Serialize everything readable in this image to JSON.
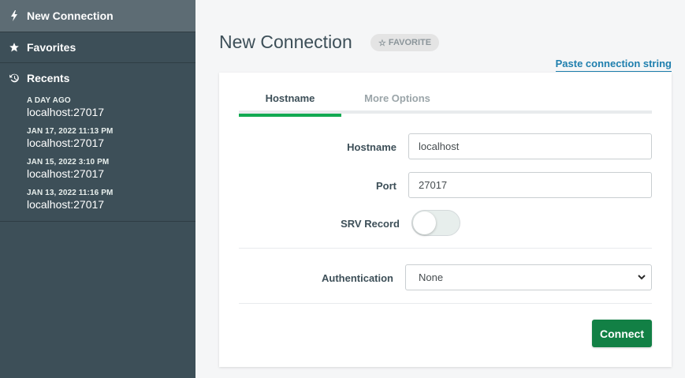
{
  "sidebar": {
    "new_connection": {
      "label": "New Connection",
      "icon": "lightning-bolt-icon"
    },
    "favorites": {
      "label": "Favorites",
      "icon": "star-icon"
    },
    "recents": {
      "label": "Recents",
      "icon": "history-icon"
    },
    "recent_items": [
      {
        "time": "A DAY AGO",
        "host": "localhost:27017"
      },
      {
        "time": "JAN 17, 2022 11:13 PM",
        "host": "localhost:27017"
      },
      {
        "time": "JAN 15, 2022 3:10 PM",
        "host": "localhost:27017"
      },
      {
        "time": "JAN 13, 2022 11:16 PM",
        "host": "localhost:27017"
      }
    ]
  },
  "header": {
    "title": "New Connection",
    "favorite_label": "FAVORITE",
    "paste_link": "Paste connection string"
  },
  "tabs": [
    {
      "label": "Hostname",
      "active": true
    },
    {
      "label": "More Options",
      "active": false
    }
  ],
  "form": {
    "hostname_label": "Hostname",
    "hostname_value": "localhost",
    "port_label": "Port",
    "port_value": "27017",
    "srv_label": "SRV Record",
    "srv_enabled": false,
    "auth_label": "Authentication",
    "auth_value": "None",
    "connect_label": "Connect"
  },
  "colors": {
    "sidebar_bg": "#3d4f58",
    "sidebar_active": "#5d6c74",
    "accent_green": "#13aa52",
    "button_green": "#128045",
    "link_blue": "#1f7fae"
  }
}
